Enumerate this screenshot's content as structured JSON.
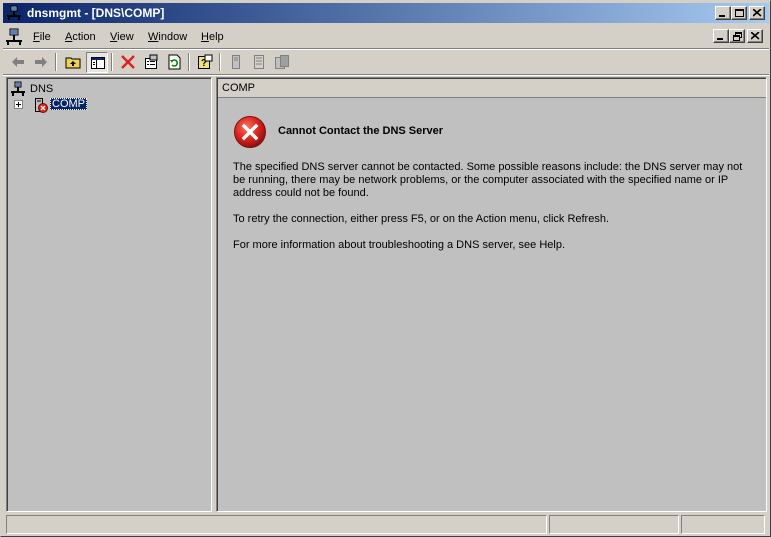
{
  "window": {
    "title": "dnsmgmt - [DNS\\COMP]"
  },
  "menu": {
    "items": [
      {
        "label": "File",
        "accel": "F",
        "rest": "ile"
      },
      {
        "label": "Action",
        "accel": "A",
        "rest": "ction"
      },
      {
        "label": "View",
        "accel": "V",
        "rest": "iew"
      },
      {
        "label": "Window",
        "accel": "W",
        "rest": "indow"
      },
      {
        "label": "Help",
        "accel": "H",
        "rest": "elp"
      }
    ]
  },
  "toolbar": {
    "icons": [
      "back-arrow-icon",
      "forward-arrow-icon",
      "up-folder-icon",
      "show-hide-tree-icon",
      "delete-icon",
      "properties-icon",
      "refresh-icon",
      "help-icon",
      "server-icon",
      "server-list-icon",
      "servers-icon"
    ]
  },
  "tree": {
    "root": "DNS",
    "child": "COMP"
  },
  "content": {
    "header": "COMP",
    "error_title": "Cannot Contact the DNS Server",
    "paragraph_1": "The specified DNS server cannot be contacted. Some possible reasons include: the DNS server may not be running, there may be network problems, or the computer associated with the specified name or IP address could not be found.",
    "paragraph_2": "To retry the connection, either press F5, or on the Action menu, click Refresh.",
    "paragraph_3": "For more information about troubleshooting a DNS server, see Help."
  },
  "colors": {
    "titlebar_start": "#0a246a",
    "titlebar_end": "#a6caf0",
    "error_red": "#d8241c",
    "window_face": "#d4d0c8"
  }
}
